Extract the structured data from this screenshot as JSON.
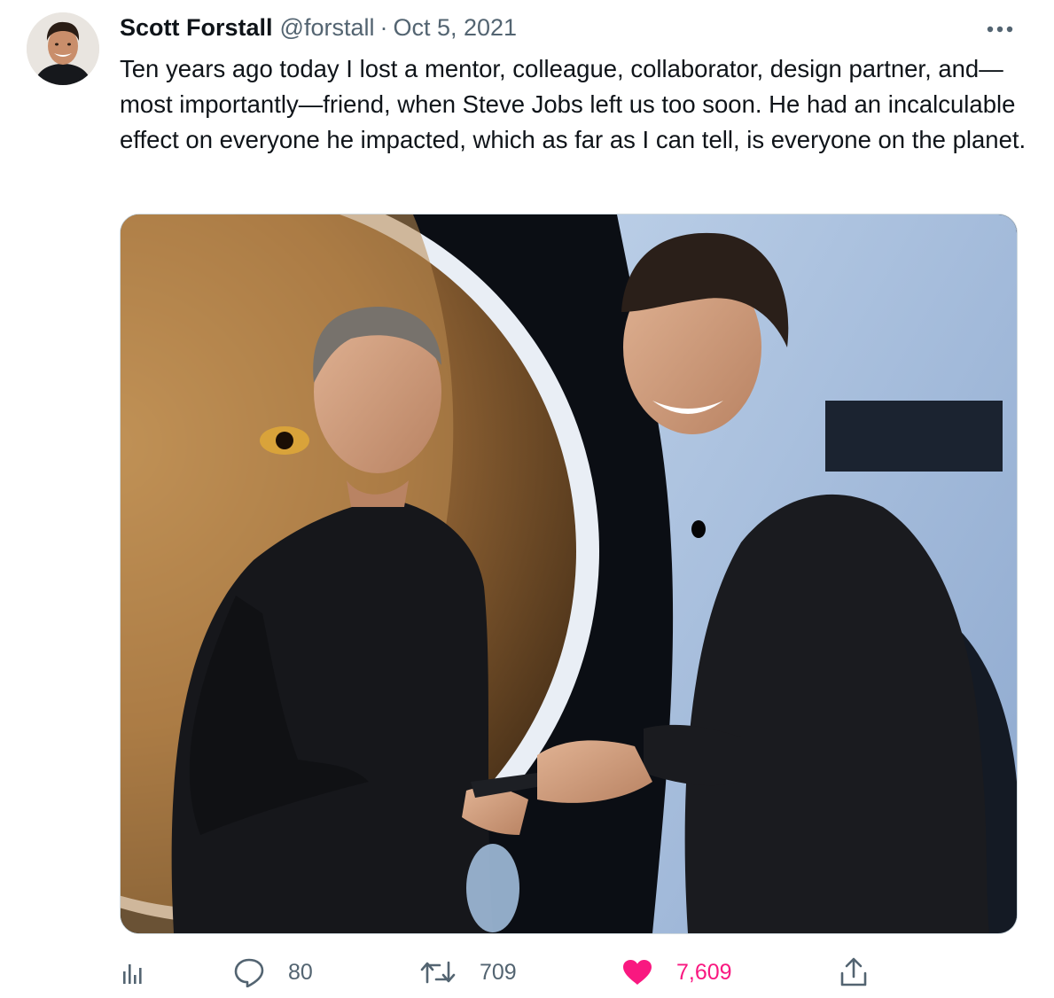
{
  "tweet": {
    "author_name": "Scott Forstall",
    "handle": "@forstall",
    "separator": "·",
    "date": "Oct 5, 2021",
    "text": "Ten years ago today I lost a mentor, colleague, collaborator, design partner, and—most importantly—friend, when Steve Jobs left us too soon. He had an incalculable effect on everyone he impacted, which as far as I can tell, is everyone on the planet."
  },
  "actions": {
    "replies": "80",
    "retweets": "709",
    "likes": "7,609",
    "liked": true
  },
  "icons": [
    "more-icon",
    "analytics-icon",
    "reply-icon",
    "retweet-icon",
    "heart-icon",
    "share-icon"
  ],
  "colors": {
    "text": "#0f1419",
    "secondary": "#536471",
    "like": "#f91880",
    "border": "#cfd9de"
  }
}
